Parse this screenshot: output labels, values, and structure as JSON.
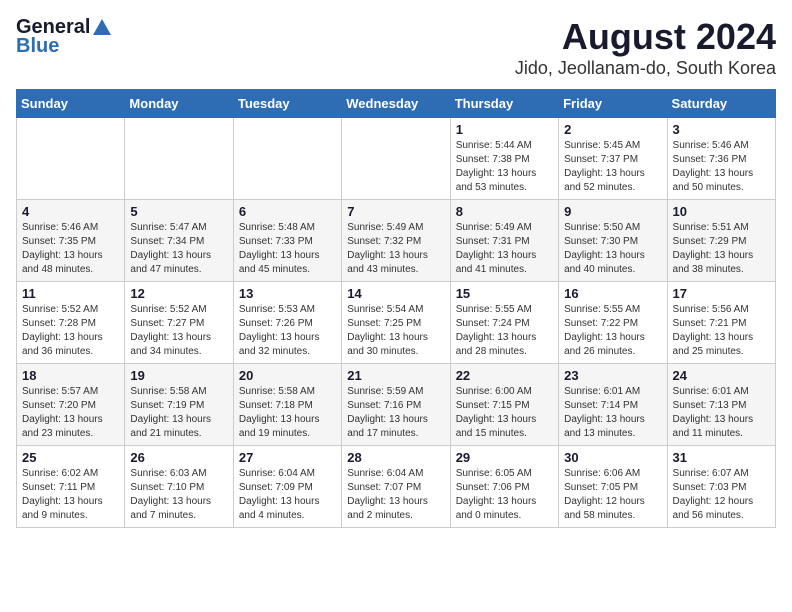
{
  "logo": {
    "general": "General",
    "blue": "Blue"
  },
  "title": "August 2024",
  "subtitle": "Jido, Jeollanam-do, South Korea",
  "days_of_week": [
    "Sunday",
    "Monday",
    "Tuesday",
    "Wednesday",
    "Thursday",
    "Friday",
    "Saturday"
  ],
  "weeks": [
    [
      {
        "day": "",
        "info": ""
      },
      {
        "day": "",
        "info": ""
      },
      {
        "day": "",
        "info": ""
      },
      {
        "day": "",
        "info": ""
      },
      {
        "day": "1",
        "info": "Sunrise: 5:44 AM\nSunset: 7:38 PM\nDaylight: 13 hours\nand 53 minutes."
      },
      {
        "day": "2",
        "info": "Sunrise: 5:45 AM\nSunset: 7:37 PM\nDaylight: 13 hours\nand 52 minutes."
      },
      {
        "day": "3",
        "info": "Sunrise: 5:46 AM\nSunset: 7:36 PM\nDaylight: 13 hours\nand 50 minutes."
      }
    ],
    [
      {
        "day": "4",
        "info": "Sunrise: 5:46 AM\nSunset: 7:35 PM\nDaylight: 13 hours\nand 48 minutes."
      },
      {
        "day": "5",
        "info": "Sunrise: 5:47 AM\nSunset: 7:34 PM\nDaylight: 13 hours\nand 47 minutes."
      },
      {
        "day": "6",
        "info": "Sunrise: 5:48 AM\nSunset: 7:33 PM\nDaylight: 13 hours\nand 45 minutes."
      },
      {
        "day": "7",
        "info": "Sunrise: 5:49 AM\nSunset: 7:32 PM\nDaylight: 13 hours\nand 43 minutes."
      },
      {
        "day": "8",
        "info": "Sunrise: 5:49 AM\nSunset: 7:31 PM\nDaylight: 13 hours\nand 41 minutes."
      },
      {
        "day": "9",
        "info": "Sunrise: 5:50 AM\nSunset: 7:30 PM\nDaylight: 13 hours\nand 40 minutes."
      },
      {
        "day": "10",
        "info": "Sunrise: 5:51 AM\nSunset: 7:29 PM\nDaylight: 13 hours\nand 38 minutes."
      }
    ],
    [
      {
        "day": "11",
        "info": "Sunrise: 5:52 AM\nSunset: 7:28 PM\nDaylight: 13 hours\nand 36 minutes."
      },
      {
        "day": "12",
        "info": "Sunrise: 5:52 AM\nSunset: 7:27 PM\nDaylight: 13 hours\nand 34 minutes."
      },
      {
        "day": "13",
        "info": "Sunrise: 5:53 AM\nSunset: 7:26 PM\nDaylight: 13 hours\nand 32 minutes."
      },
      {
        "day": "14",
        "info": "Sunrise: 5:54 AM\nSunset: 7:25 PM\nDaylight: 13 hours\nand 30 minutes."
      },
      {
        "day": "15",
        "info": "Sunrise: 5:55 AM\nSunset: 7:24 PM\nDaylight: 13 hours\nand 28 minutes."
      },
      {
        "day": "16",
        "info": "Sunrise: 5:55 AM\nSunset: 7:22 PM\nDaylight: 13 hours\nand 26 minutes."
      },
      {
        "day": "17",
        "info": "Sunrise: 5:56 AM\nSunset: 7:21 PM\nDaylight: 13 hours\nand 25 minutes."
      }
    ],
    [
      {
        "day": "18",
        "info": "Sunrise: 5:57 AM\nSunset: 7:20 PM\nDaylight: 13 hours\nand 23 minutes."
      },
      {
        "day": "19",
        "info": "Sunrise: 5:58 AM\nSunset: 7:19 PM\nDaylight: 13 hours\nand 21 minutes."
      },
      {
        "day": "20",
        "info": "Sunrise: 5:58 AM\nSunset: 7:18 PM\nDaylight: 13 hours\nand 19 minutes."
      },
      {
        "day": "21",
        "info": "Sunrise: 5:59 AM\nSunset: 7:16 PM\nDaylight: 13 hours\nand 17 minutes."
      },
      {
        "day": "22",
        "info": "Sunrise: 6:00 AM\nSunset: 7:15 PM\nDaylight: 13 hours\nand 15 minutes."
      },
      {
        "day": "23",
        "info": "Sunrise: 6:01 AM\nSunset: 7:14 PM\nDaylight: 13 hours\nand 13 minutes."
      },
      {
        "day": "24",
        "info": "Sunrise: 6:01 AM\nSunset: 7:13 PM\nDaylight: 13 hours\nand 11 minutes."
      }
    ],
    [
      {
        "day": "25",
        "info": "Sunrise: 6:02 AM\nSunset: 7:11 PM\nDaylight: 13 hours\nand 9 minutes."
      },
      {
        "day": "26",
        "info": "Sunrise: 6:03 AM\nSunset: 7:10 PM\nDaylight: 13 hours\nand 7 minutes."
      },
      {
        "day": "27",
        "info": "Sunrise: 6:04 AM\nSunset: 7:09 PM\nDaylight: 13 hours\nand 4 minutes."
      },
      {
        "day": "28",
        "info": "Sunrise: 6:04 AM\nSunset: 7:07 PM\nDaylight: 13 hours\nand 2 minutes."
      },
      {
        "day": "29",
        "info": "Sunrise: 6:05 AM\nSunset: 7:06 PM\nDaylight: 13 hours\nand 0 minutes."
      },
      {
        "day": "30",
        "info": "Sunrise: 6:06 AM\nSunset: 7:05 PM\nDaylight: 12 hours\nand 58 minutes."
      },
      {
        "day": "31",
        "info": "Sunrise: 6:07 AM\nSunset: 7:03 PM\nDaylight: 12 hours\nand 56 minutes."
      }
    ]
  ]
}
